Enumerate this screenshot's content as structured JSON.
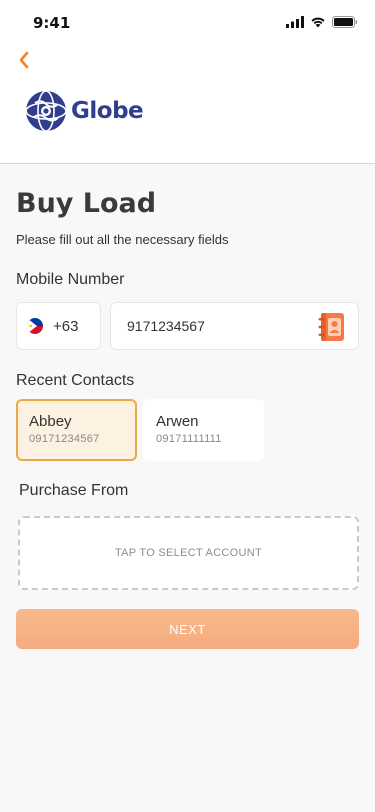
{
  "status_bar": {
    "time": "9:41"
  },
  "header": {
    "back_icon": "chevron-left-icon",
    "brand_name": "Globe",
    "accent_color": "#f58220",
    "brand_color": "#2f3e8d"
  },
  "page": {
    "title": "Buy Load",
    "subtitle": "Please fill out all the necessary fields"
  },
  "mobile_number": {
    "label": "Mobile Number",
    "country_flag_icon": "philippines-flag-icon",
    "country_code": "+63",
    "value": "9171234567",
    "contacts_icon": "address-book-icon"
  },
  "recent_contacts": {
    "label": "Recent Contacts",
    "items": [
      {
        "name": "Abbey",
        "number": "09171234567",
        "selected": true
      },
      {
        "name": "Arwen",
        "number": "09171111111",
        "selected": false
      }
    ]
  },
  "purchase_from": {
    "label": "Purchase From",
    "placeholder": "TAP TO SELECT ACCOUNT"
  },
  "next_button": {
    "label": "NEXT",
    "color": "#f5b085"
  }
}
